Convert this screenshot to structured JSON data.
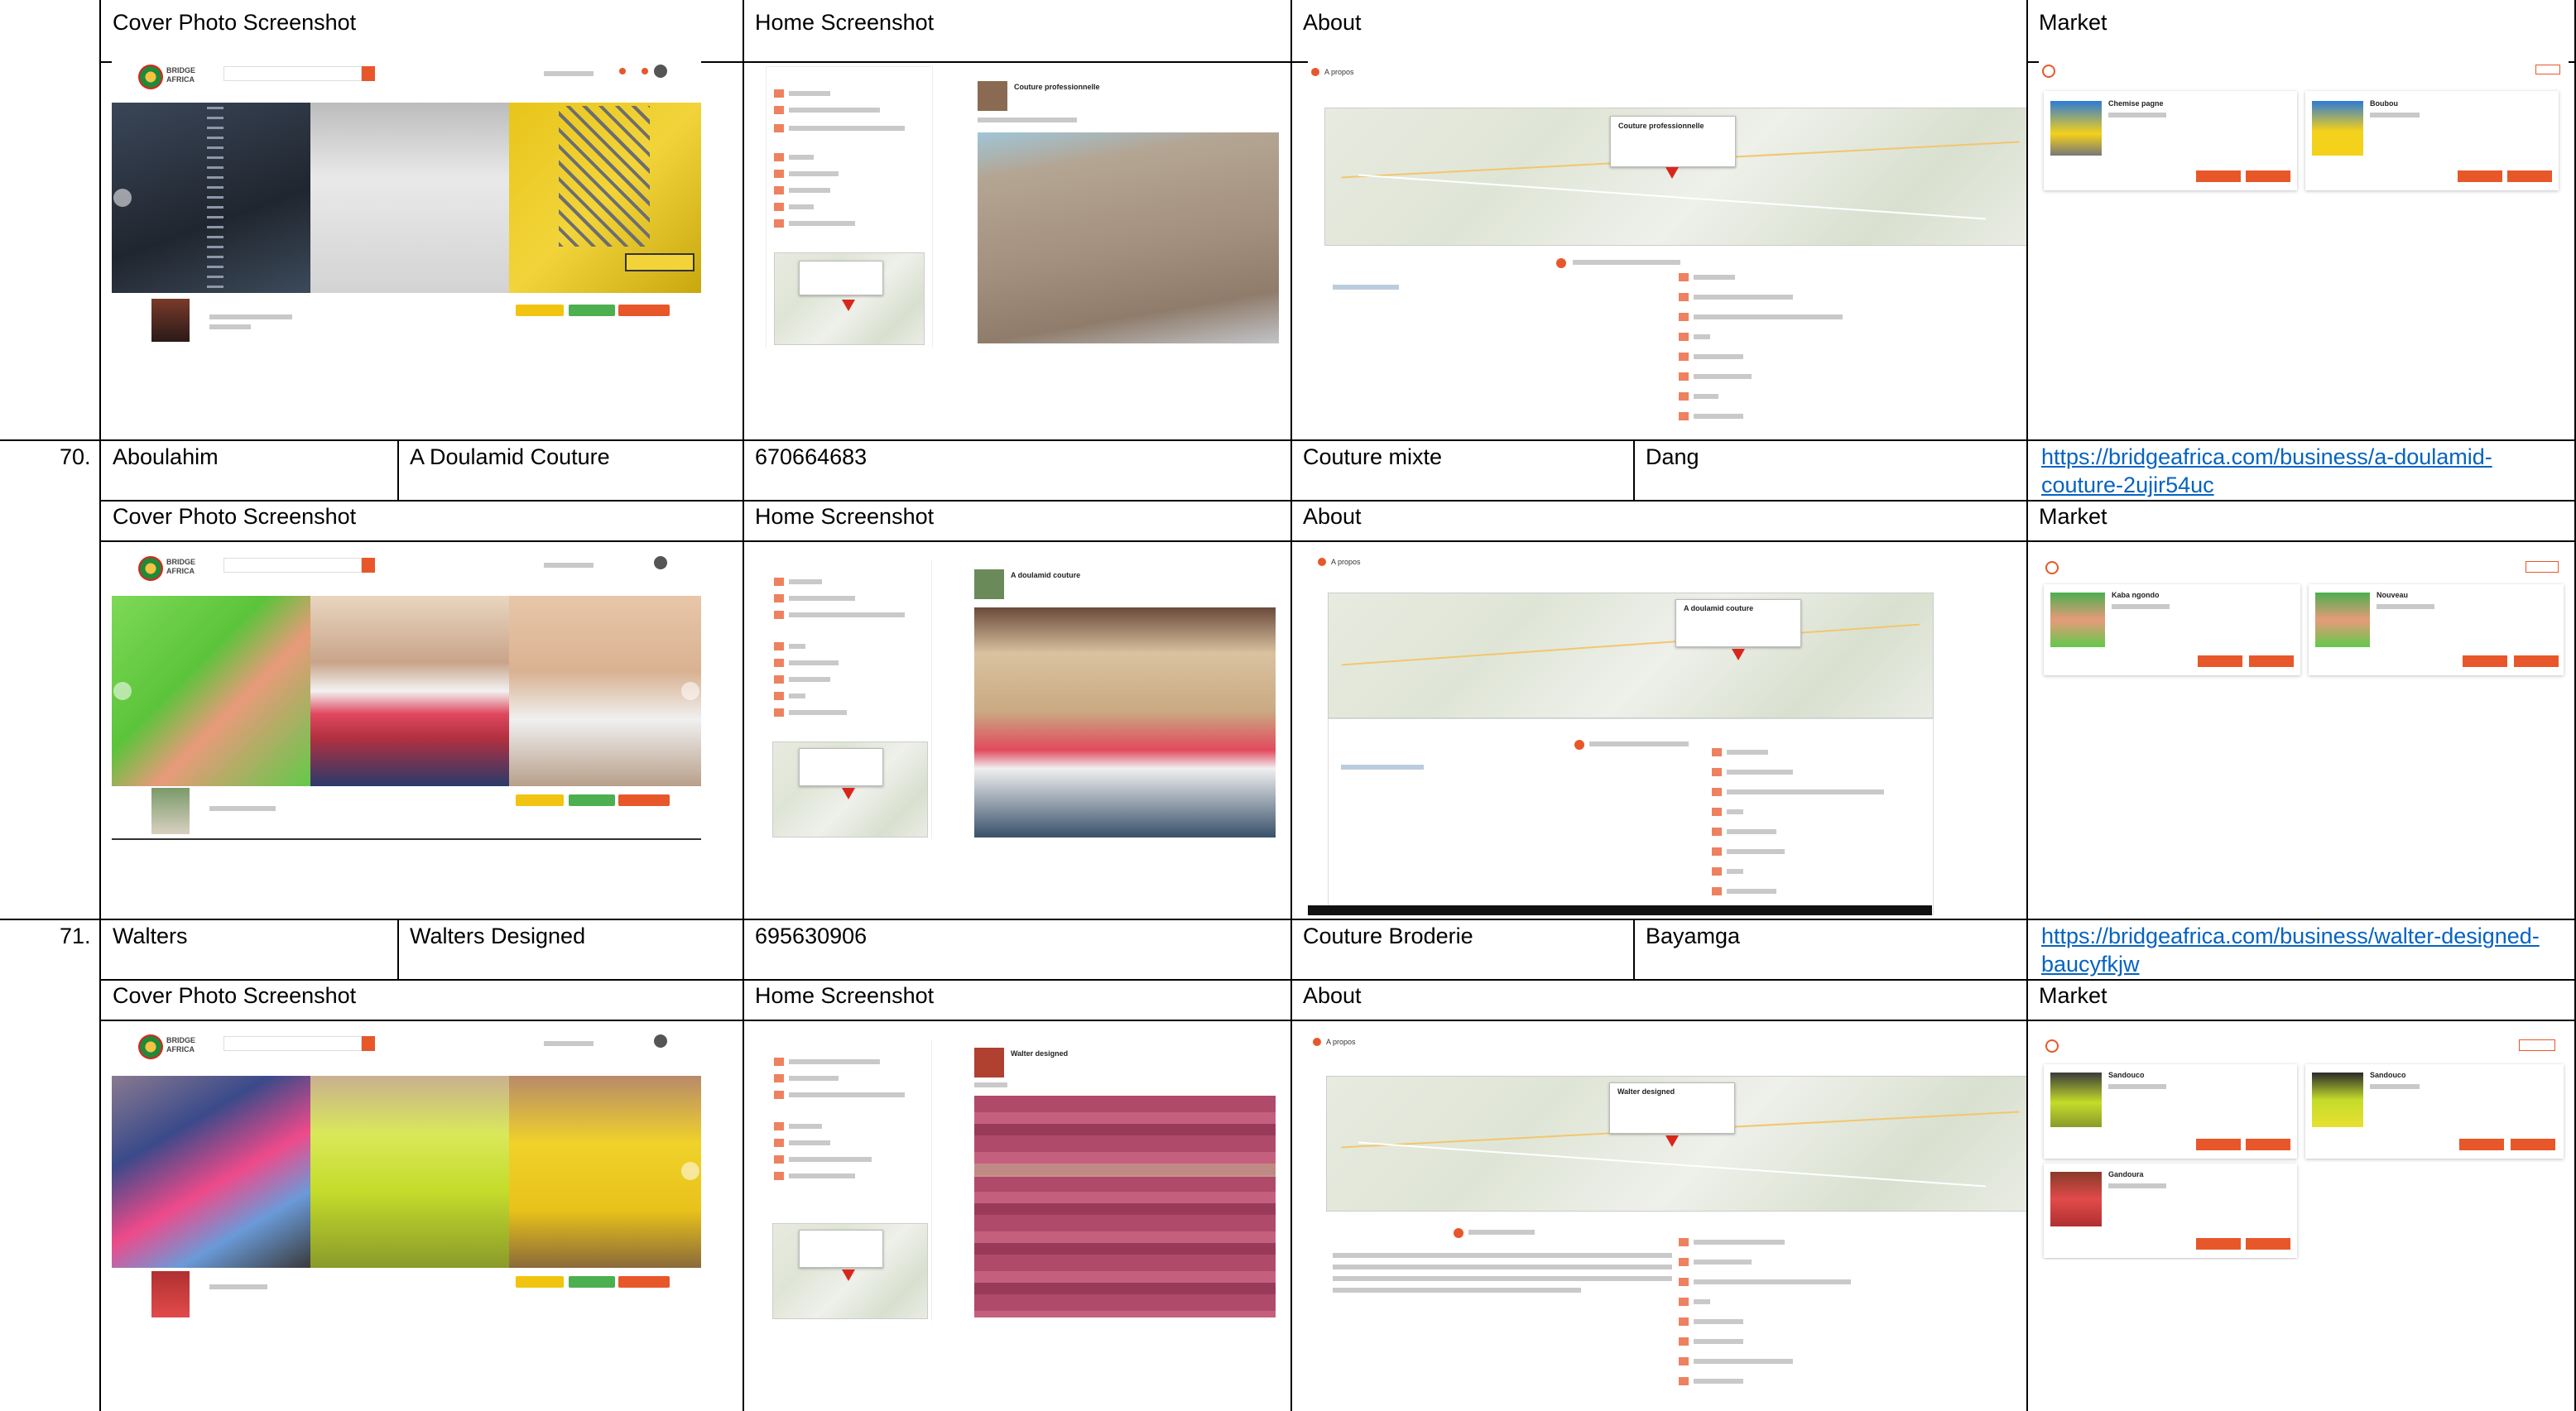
{
  "rows": [
    {
      "number": "",
      "cells": [],
      "labels": {
        "cover": "Cover Photo Screenshot",
        "home": "Home Screenshot",
        "about": "About",
        "market": "Market"
      },
      "home_title": "Couture professionnelle",
      "about_title": "Couture professionnelle",
      "market_items": [
        "Chemise pagne",
        "Boubou"
      ]
    },
    {
      "number": "70.",
      "cells": [
        "Aboulahim",
        "A Doulamid Couture",
        "670664683",
        "Couture mixte",
        "Dang"
      ],
      "link": "https://bridgeafrica.com/business/a-doulamid-couture-2ujir54uc",
      "labels": {
        "cover": "Cover Photo Screenshot",
        "home": "Home Screenshot",
        "about": "About",
        "market": "Market"
      },
      "home_title": "A doulamid couture",
      "about_title": "A doulamid couture",
      "market_items": [
        "Kaba ngondo",
        "Nouveau"
      ]
    },
    {
      "number": "71.",
      "cells": [
        "Walters",
        "Walters Designed",
        "695630906",
        "Couture Broderie",
        "Bayamga"
      ],
      "link": "https://bridgeafrica.com/business/walter-designed-baucyfkjw",
      "labels": {
        "cover": "Cover Photo Screenshot",
        "home": "Home Screenshot",
        "about": "About",
        "market": "Market"
      },
      "home_title": "Walter designed",
      "about_title": "Walter designed",
      "market_items": [
        "Sandouco",
        "Sandouco",
        "Gandoura"
      ]
    }
  ],
  "bridge_logo_text": "BRIDGE AFRICA",
  "about_header": "A propos",
  "colors": {
    "accent": "#e8572a",
    "link": "#0563c1",
    "yellow": "#f1c40f",
    "green": "#4caf50"
  }
}
